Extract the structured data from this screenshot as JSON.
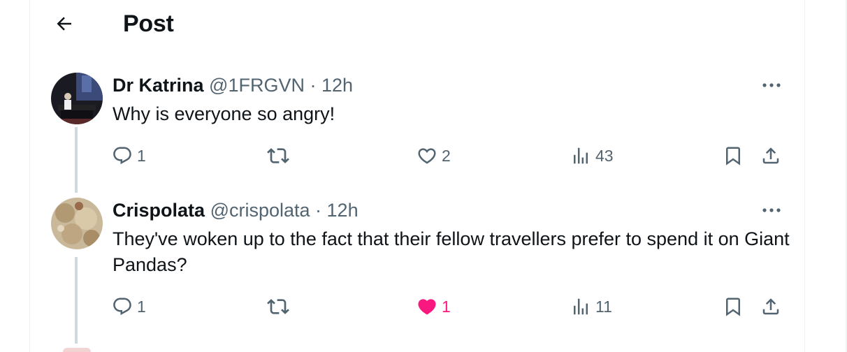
{
  "header": {
    "title": "Post"
  },
  "tweets": [
    {
      "name": "Dr Katrina",
      "handle": "@1FRGVN",
      "time": "· 12h",
      "text": "Why is everyone so angry!",
      "replies": "1",
      "likes": "2",
      "views": "43",
      "liked": false
    },
    {
      "name": "Crispolata",
      "handle": "@crispolata",
      "time": "· 12h",
      "text": "They've woken up to the fact that their fellow travellers prefer to spend it on Giant Pandas?",
      "replies": "1",
      "likes": "1",
      "views": "11",
      "liked": true
    }
  ],
  "colors": {
    "text": "#0f1419",
    "secondary": "#536471",
    "like_active": "#f91880",
    "thread_line": "#cfd9de"
  }
}
